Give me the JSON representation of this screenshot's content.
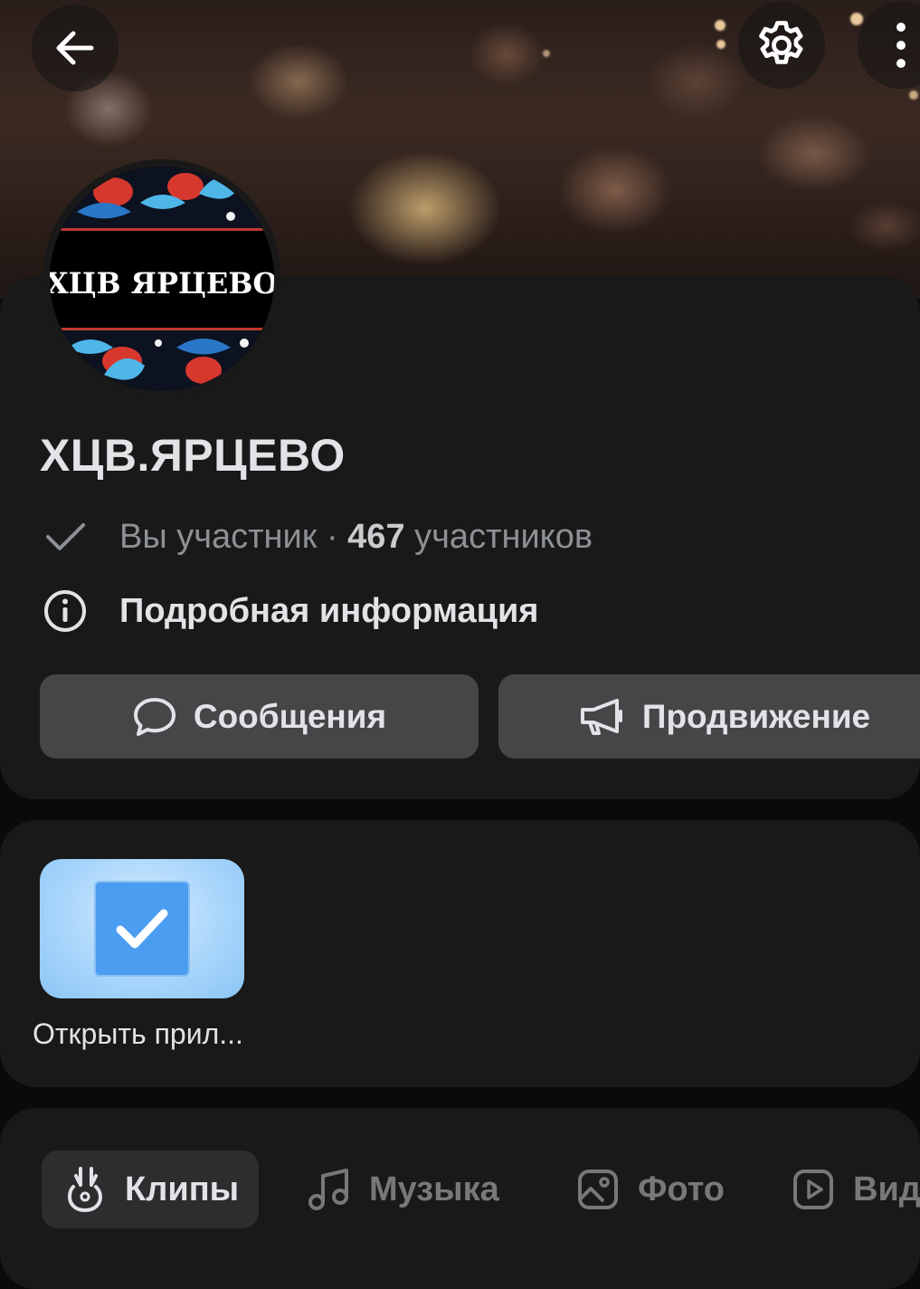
{
  "header": {
    "back_icon": "arrow-left-icon",
    "settings_icon": "gear-icon",
    "more_icon": "more-vertical-icon"
  },
  "group": {
    "avatar_text": "†ХЦВ ЯРЦЕВО†",
    "name": "ХЦВ.ЯРЦЕВО",
    "membership_status": "Вы участник",
    "separator": " · ",
    "members_count": "467",
    "members_label": " участников",
    "details_label": "Подробная информация"
  },
  "actions": {
    "messages_label": "Сообщения",
    "promotion_label": "Продвижение"
  },
  "apps": {
    "open_app_label": "Открыть прил..."
  },
  "tabs": [
    {
      "label": "Клипы",
      "icon": "clips-icon",
      "active": true
    },
    {
      "label": "Музыка",
      "icon": "music-note-icon",
      "active": false
    },
    {
      "label": "Фото",
      "icon": "photo-icon",
      "active": false
    },
    {
      "label": "Вид",
      "icon": "video-icon",
      "active": false
    }
  ],
  "colors": {
    "background": "#0a0a0a",
    "card": "#191919",
    "button": "#454647",
    "text_primary": "#e1e3e6",
    "text_secondary": "#8d9196",
    "accent_blue": "#4a9df0"
  }
}
